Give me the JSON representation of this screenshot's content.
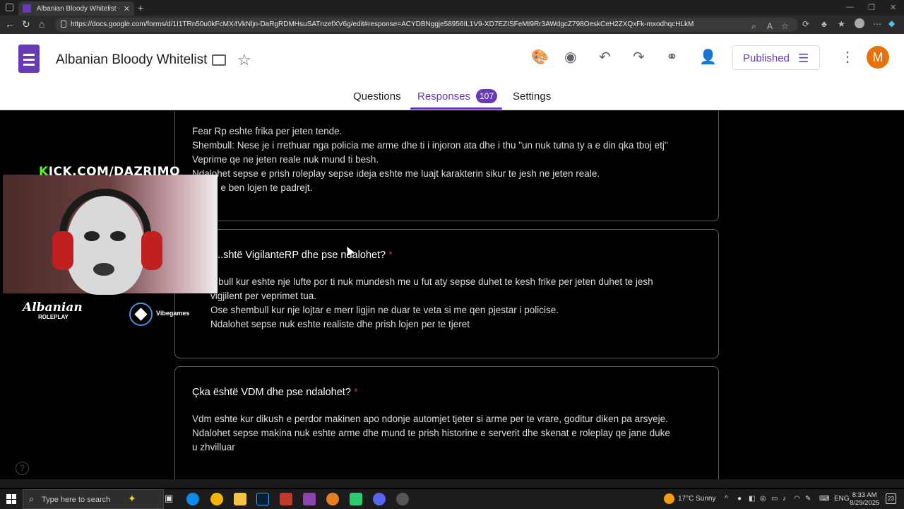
{
  "browser": {
    "tab_title": "Albanian Bloody Whitelist - Google Forms",
    "url": "https://docs.google.com/forms/d/1I1TRn50u0kFcMX4VkNljn-DaRgRDMHsuSATnzefXV6g/edit#response=ACYDBNggje58956IL1V9-XD7EZISFeMI9Rr3AWdgcZ798OeskCeH2ZXQxFk-mxodhqcHLkM"
  },
  "header": {
    "form_title": "Albanian Bloody Whitelist",
    "publish_label": "Published",
    "avatar_letter": "M"
  },
  "nav": {
    "questions": "Questions",
    "responses": "Responses",
    "response_count": "107",
    "settings": "Settings"
  },
  "cards": [
    {
      "question": "",
      "answer_lines": [
        "Fear Rp eshte frika per jeten tende.",
        "Shembull: Nese je i rrethuar nga policia me arme dhe ti i injoron ata dhe i thu \"un nuk tutna ty a e din qka tboj etj\"",
        "Veprime qe ne jeten reale nuk mund ti besh.",
        "Ndalohet sepse e prish roleplay sepse ideja eshte me luajt karakterin sikur te jesh ne jeten reale.",
        "...shtu e ben lojen te padrejt."
      ]
    },
    {
      "question": "...shtë VigilanteRP dhe pse ndalohet?",
      "required": "*",
      "answer_lines": [
        "...bull kur eshte nje lufte por ti nuk mundesh me u fut aty sepse duhet te kesh frike per jeten duhet te jesh",
        "vigjilent per veprimet tua.",
        "Ose shembull kur nje lojtar e merr ligjin ne duar te veta si me qen pjestar i policise.",
        "Ndalohet sepse nuk eshte realiste dhe prish  lojen per te tjeret"
      ]
    },
    {
      "question": "Çka është VDM dhe pse ndalohet?",
      "required": "*",
      "answer_lines": [
        "Vdm eshte kur dikush e perdor makinen apo ndonje automjet tjeter si arme per te vrare, goditur diken pa arsyeje.",
        "Ndalohet sepse makina nuk eshte arme dhe mund te prish historine e serverit dhe skenat e roleplay qe jane duke",
        "u zhvilluar"
      ]
    }
  ],
  "overlay": {
    "kick_prefix": "K",
    "kick_rest": "ICK.COM/DAZRIMO",
    "logo_main": "Albanian",
    "logo_sub": "ROLEPLAY",
    "sponsor": "Vibegames"
  },
  "taskbar": {
    "search_placeholder": "Type here to search",
    "weather": "17°C  Sunny",
    "language": "ENG",
    "time": "8:33 AM",
    "date": "8/29/2025",
    "notifications": "23"
  },
  "icons": [
    "palette-icon",
    "eye-icon",
    "undo-icon",
    "redo-icon",
    "link-icon",
    "add-person-icon",
    "tune-icon",
    "more-vert-icon",
    "folder-icon",
    "star-icon",
    "help-icon"
  ]
}
